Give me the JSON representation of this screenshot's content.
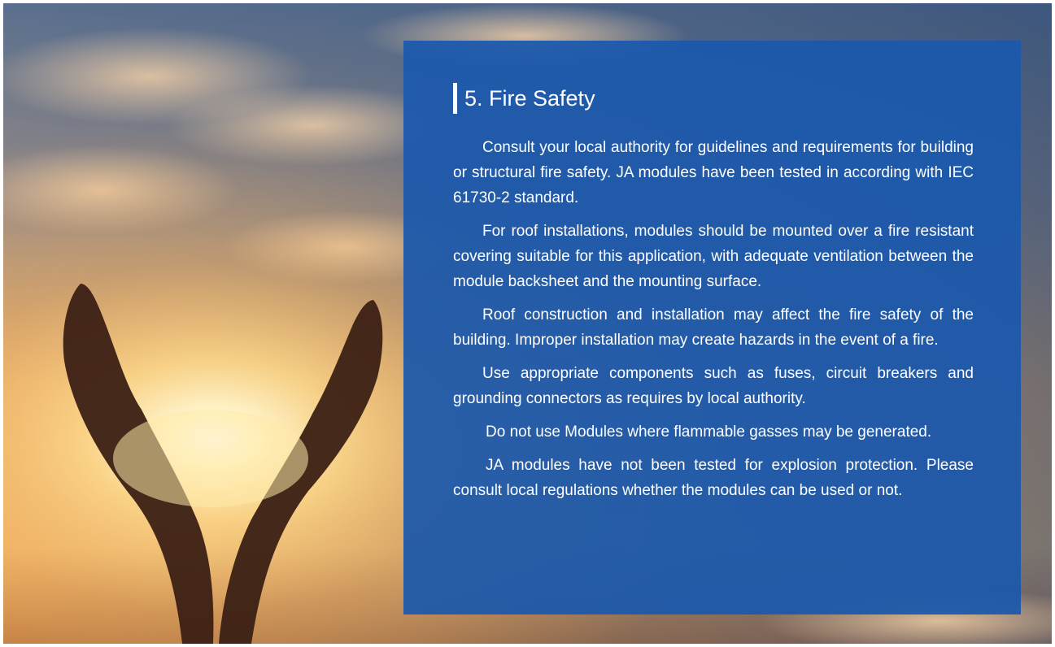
{
  "section": {
    "title": "5. Fire Safety",
    "paragraphs": [
      "Consult your local authority for guidelines and requirements for building or structural fire safety. JA modules have been tested in according with IEC 61730-2 standard.",
      "For roof installations, modules should be mounted over a fire resistant covering suitable for this application, with adequate ventilation between the module backsheet and the mounting surface.",
      "Roof construction and installation may affect the fire safety of the building. Improper installation may create hazards in the event of a fire.",
      "Use appropriate components such as fuses, circuit breakers and grounding connectors as requires by local authority.",
      "Do not use Modules where flammable gasses may be generated.",
      "JA modules have not been tested for explosion protection. Please consult local regulations whether the modules can be used or not."
    ]
  },
  "background": {
    "subject": "hands-holding-sun-photo",
    "colors": {
      "sky_top": "#3b5f8c",
      "sun_glow": "#fff3c4",
      "warm": "#e9a45a",
      "hands": "#3a1f12",
      "panel": "#1b58ac"
    }
  }
}
